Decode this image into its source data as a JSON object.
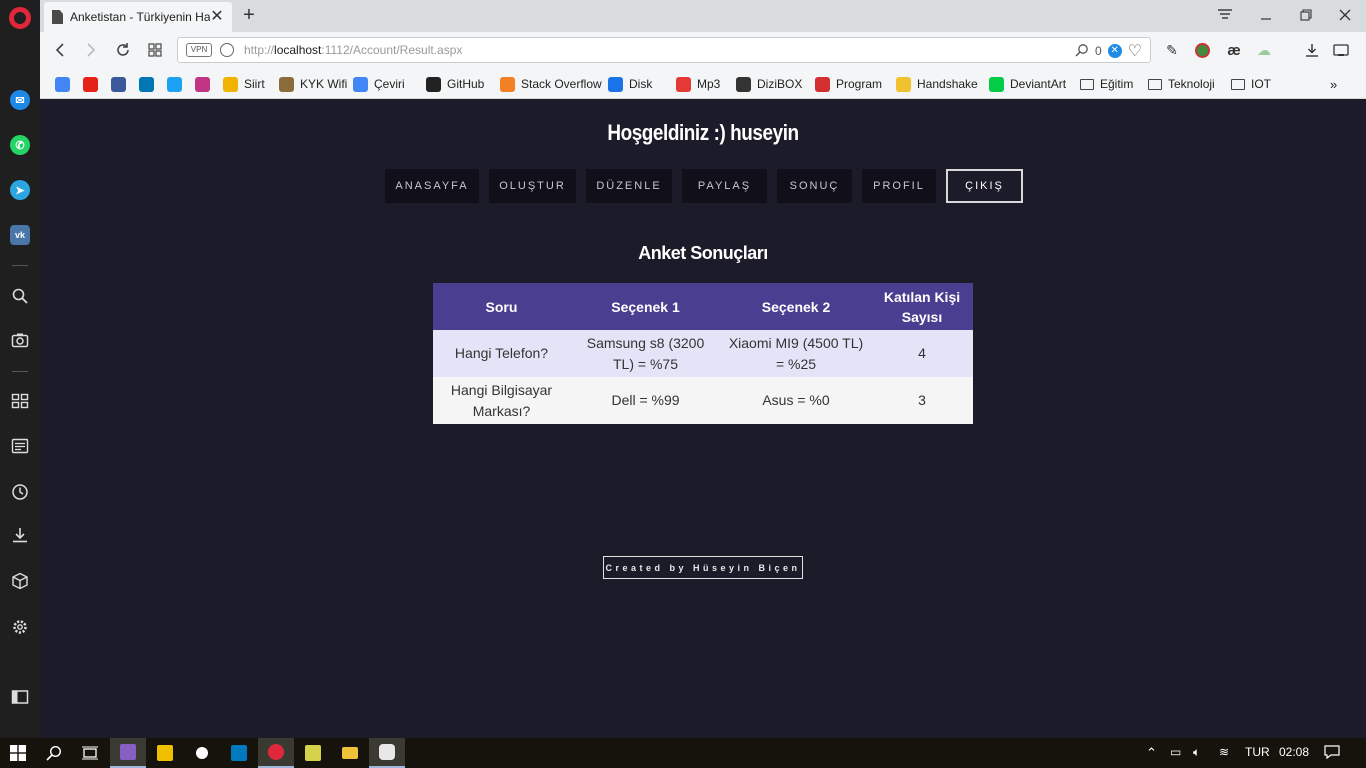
{
  "browser": {
    "tab_title": "Anketistan - Türkiyenin Ha",
    "url_protocol": "http://",
    "url_host": "localhost",
    "url_path": ":1112/Account/Result.aspx",
    "vpn_label": "VPN",
    "blocker_count": "0"
  },
  "bookmarks": [
    {
      "label": "",
      "icon": "google-icon",
      "color": "#4285f4"
    },
    {
      "label": "",
      "icon": "youtube-icon",
      "color": "#e62117"
    },
    {
      "label": "",
      "icon": "facebook-icon",
      "color": "#3b5998"
    },
    {
      "label": "",
      "icon": "linkedin-icon",
      "color": "#0077b5"
    },
    {
      "label": "",
      "icon": "twitter-icon",
      "color": "#1da1f2"
    },
    {
      "label": "",
      "icon": "instagram-icon",
      "color": "#c13584"
    },
    {
      "label": "Siirt",
      "icon": "siirt-icon",
      "color": "#f0b400"
    },
    {
      "label": "KYK Wifi",
      "icon": "kyk-icon",
      "color": "#8a6d3b"
    },
    {
      "label": "Çeviri",
      "icon": "translate-icon",
      "color": "#4285f4"
    },
    {
      "label": "GitHub",
      "icon": "github-icon",
      "color": "#222222"
    },
    {
      "label": "Stack Overflow",
      "icon": "stackoverflow-icon",
      "color": "#f48024"
    },
    {
      "label": "Disk",
      "icon": "disk-icon",
      "color": "#1a73e8"
    },
    {
      "label": "Mp3",
      "icon": "mp3-icon",
      "color": "#e53935"
    },
    {
      "label": "DiziBOX",
      "icon": "dizibox-icon",
      "color": "#333333"
    },
    {
      "label": "Program",
      "icon": "program-icon",
      "color": "#d32f2f"
    },
    {
      "label": "Handshake",
      "icon": "handshake-icon",
      "color": "#f2c12e"
    },
    {
      "label": "DeviantArt",
      "icon": "deviantart-icon",
      "color": "#05cc47"
    },
    {
      "label": "Eğitim",
      "icon": "folder-icon",
      "color": ""
    },
    {
      "label": "Teknoloji",
      "icon": "folder-icon",
      "color": ""
    },
    {
      "label": "IOT",
      "icon": "folder-icon",
      "color": ""
    }
  ],
  "page": {
    "welcome": "Hoşgeldiniz :) huseyin",
    "nav": [
      "ANASAYFA",
      "OLUŞTUR",
      "DÜZENLE",
      "PAYLAŞ",
      "SONUÇ",
      "PROFIL",
      "ÇIKIŞ"
    ],
    "section_title": "Anket Sonuçları",
    "table": {
      "headers": [
        "Soru",
        "Seçenek 1",
        "Seçenek 2",
        "Katılan Kişi Sayısı"
      ],
      "rows": [
        [
          "Hangi Telefon?",
          "Samsung s8 (3200 TL) = %75",
          "Xiaomi MI9 (4500 TL) = %25",
          "4"
        ],
        [
          "Hangi Bilgisayar Markası?",
          "Dell = %99",
          "Asus = %0",
          "3"
        ]
      ]
    },
    "footer": "Created by Hüseyin Biçen"
  },
  "taskbar": {
    "language": "TUR",
    "time": "02:08"
  },
  "colors": {
    "page_bg": "#1c1b29",
    "table_header": "#493e8f",
    "row_odd": "#e4e4f8",
    "row_even": "#f5f5f5",
    "opera_red": "#e0283a"
  }
}
